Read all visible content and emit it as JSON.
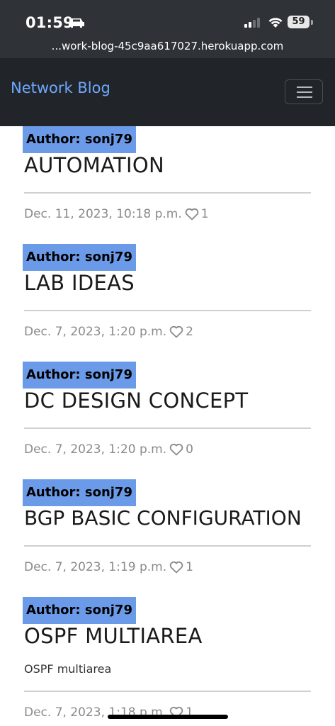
{
  "status_bar": {
    "time": "01:59",
    "battery": "59",
    "url": "...work-blog-45c9aa617027.herokuapp.com"
  },
  "navbar": {
    "brand": "Network Blog",
    "brand_color": "#6ea8fe",
    "toggler_icon": "hamburger-icon"
  },
  "posts": [
    {
      "author": "Author: sonj79",
      "title": "AUTOMATION",
      "excerpt": "",
      "date": "Dec. 11, 2023, 10:18 p.m.",
      "likes": "1"
    },
    {
      "author": "Author: sonj79",
      "title": "LAB IDEAS",
      "excerpt": "",
      "date": "Dec. 7, 2023, 1:20 p.m.",
      "likes": "2"
    },
    {
      "author": "Author: sonj79",
      "title": "DC DESIGN CONCEPT",
      "excerpt": "",
      "date": "Dec. 7, 2023, 1:20 p.m.",
      "likes": "0"
    },
    {
      "author": "Author: sonj79",
      "title": "BGP BASIC CONFIGURATION",
      "excerpt": "",
      "date": "Dec. 7, 2023, 1:19 p.m.",
      "likes": "1"
    },
    {
      "author": "Author: sonj79",
      "title": "OSPF MULTIAREA",
      "excerpt": "OSPF multiarea",
      "date": "Dec. 7, 2023, 1:18 p.m.",
      "likes": "1"
    }
  ],
  "colors": {
    "author_badge": "#6b9be8",
    "navbar_bg": "#212529"
  },
  "icons": {
    "like": "heart-outline-icon"
  }
}
